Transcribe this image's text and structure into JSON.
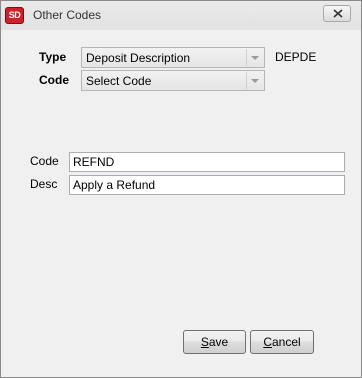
{
  "window": {
    "title": "Other Codes",
    "app_icon_text": "SD"
  },
  "form": {
    "type_label": "Type",
    "type_value": "Deposit Description",
    "type_code": "DEPDE",
    "code_label": "Code",
    "code_value": "Select Code",
    "code_field_label": "Code",
    "code_field_value": "REFND",
    "desc_field_label": "Desc",
    "desc_field_value": "Apply a Refund"
  },
  "buttons": {
    "save_accel": "S",
    "save_rest": "ave",
    "cancel_accel": "C",
    "cancel_rest": "ancel"
  },
  "icons": {
    "close": "close-icon",
    "dropdown": "chevron-down-icon"
  },
  "colors": {
    "app_icon": "#d0202a",
    "window_bg": "#f0f0f0"
  }
}
